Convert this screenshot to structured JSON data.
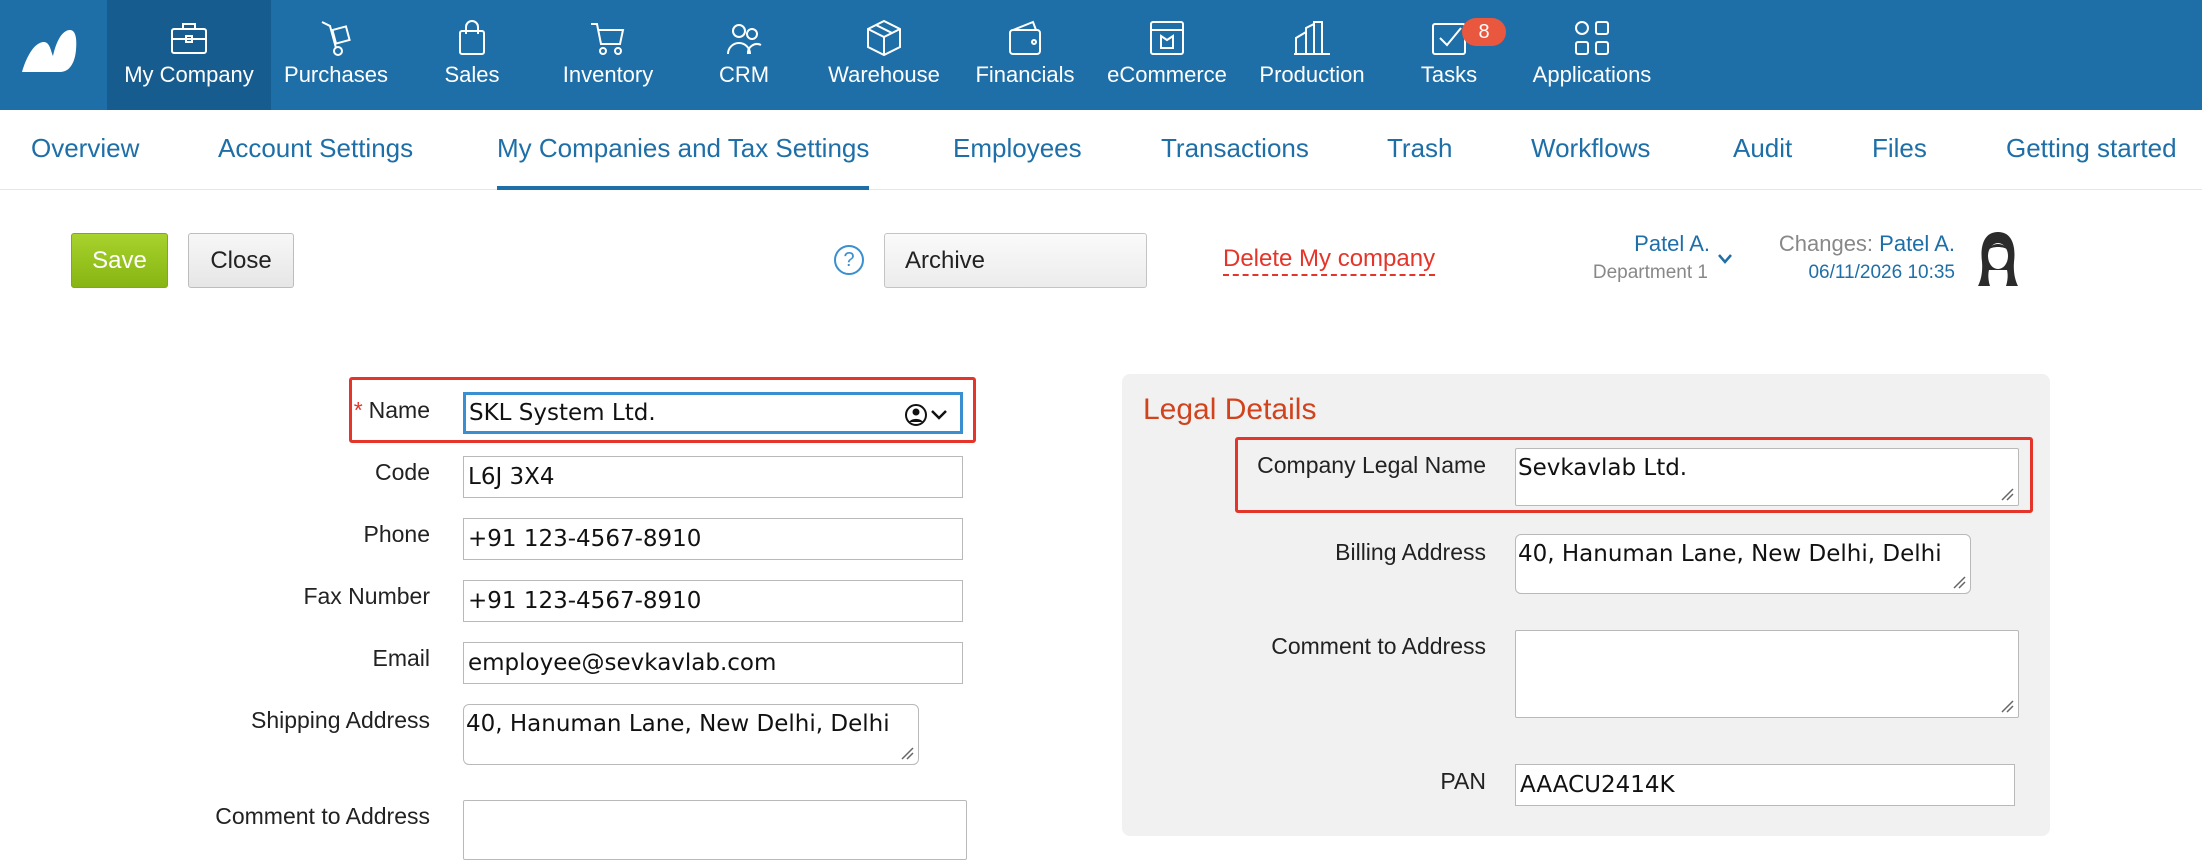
{
  "colors": {
    "topbar": "#1e6fa8",
    "active_module": "#175c8e",
    "link": "#1e6fa8",
    "badge": "#e9573f",
    "save": "#96c41c",
    "danger": "#e5352a",
    "panel_title": "#d0431c",
    "panel_bg": "#f1f1f1"
  },
  "modules": [
    {
      "label": "My Company",
      "icon": "briefcase-icon",
      "active": true
    },
    {
      "label": "Purchases",
      "icon": "hand-truck-icon"
    },
    {
      "label": "Sales",
      "icon": "shopping-bag-icon"
    },
    {
      "label": "Inventory",
      "icon": "cart-icon"
    },
    {
      "label": "CRM",
      "icon": "people-icon"
    },
    {
      "label": "Warehouse",
      "icon": "box-icon"
    },
    {
      "label": "Financials",
      "icon": "wallet-icon"
    },
    {
      "label": "eCommerce",
      "icon": "storefront-icon"
    },
    {
      "label": "Production",
      "icon": "factory-icon"
    },
    {
      "label": "Tasks",
      "icon": "checkbox-icon",
      "badge": "8"
    },
    {
      "label": "Applications",
      "icon": "apps-grid-icon"
    }
  ],
  "tabs": [
    {
      "label": "Overview"
    },
    {
      "label": "Account Settings"
    },
    {
      "label": "My Companies and Tax Settings",
      "active": true
    },
    {
      "label": "Employees"
    },
    {
      "label": "Transactions"
    },
    {
      "label": "Trash"
    },
    {
      "label": "Workflows"
    },
    {
      "label": "Audit"
    },
    {
      "label": "Files"
    },
    {
      "label": "Getting started"
    }
  ],
  "toolbar": {
    "save_label": "Save",
    "close_label": "Close",
    "help_glyph": "?",
    "archive_label": "Archive",
    "delete_label": "Delete My company"
  },
  "user": {
    "name": "Patel A.",
    "department": "Department 1",
    "changes_label": "Changes: ",
    "changes_by": "Patel A.",
    "changes_date": "06/11/2026 10:35"
  },
  "form": {
    "name_required_mark": "*",
    "name_label": "Name",
    "name_value": "SKL System Ltd.",
    "code_label": "Code",
    "code_value": "L6J 3X4",
    "phone_label": "Phone",
    "phone_value": "+91 123-4567-8910",
    "fax_label": "Fax Number",
    "fax_value": "+91 123-4567-8910",
    "email_label": "Email",
    "email_value": "employee@sevkavlab.com",
    "shipping_label": "Shipping Address",
    "shipping_value": "40, Hanuman Lane, New Delhi, Delhi",
    "comment_label": "Comment to Address",
    "comment_value": ""
  },
  "legal": {
    "title": "Legal Details",
    "legal_name_label": "Company Legal Name",
    "legal_name_value": "Sevkavlab Ltd.",
    "billing_label": "Billing Address",
    "billing_value": "40, Hanuman Lane, New Delhi, Delhi",
    "comment_label": "Comment to Address",
    "comment_value": "",
    "pan_label": "PAN",
    "pan_value": "AAACU2414K"
  }
}
